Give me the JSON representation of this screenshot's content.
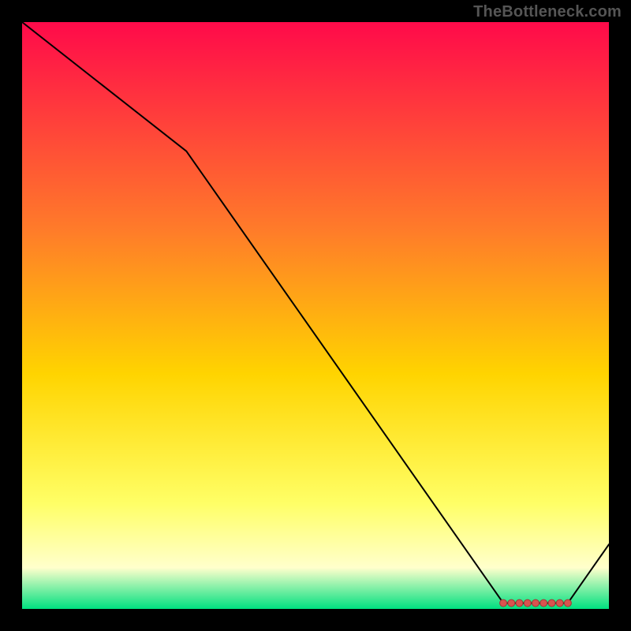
{
  "watermark": "TheBottleneck.com",
  "colors": {
    "gradient_top": "#ff0a4a",
    "gradient_upper_mid": "#ff7a2a",
    "gradient_mid": "#ffd400",
    "gradient_lower_mid": "#ffff66",
    "gradient_pale": "#ffffcc",
    "gradient_bottom": "#00e080",
    "line": "#000000",
    "marker": "#d9534f",
    "frame_bg": "#000000"
  },
  "chart_data": {
    "type": "line",
    "title": "",
    "xlabel": "",
    "ylabel": "",
    "xlim": [
      0,
      100
    ],
    "ylim": [
      0,
      100
    ],
    "x": [
      0,
      28,
      82,
      93,
      100
    ],
    "values": [
      100,
      78,
      1,
      1,
      11
    ],
    "marker_region": {
      "x_start": 82,
      "x_end": 93,
      "y": 1,
      "count": 9
    }
  }
}
